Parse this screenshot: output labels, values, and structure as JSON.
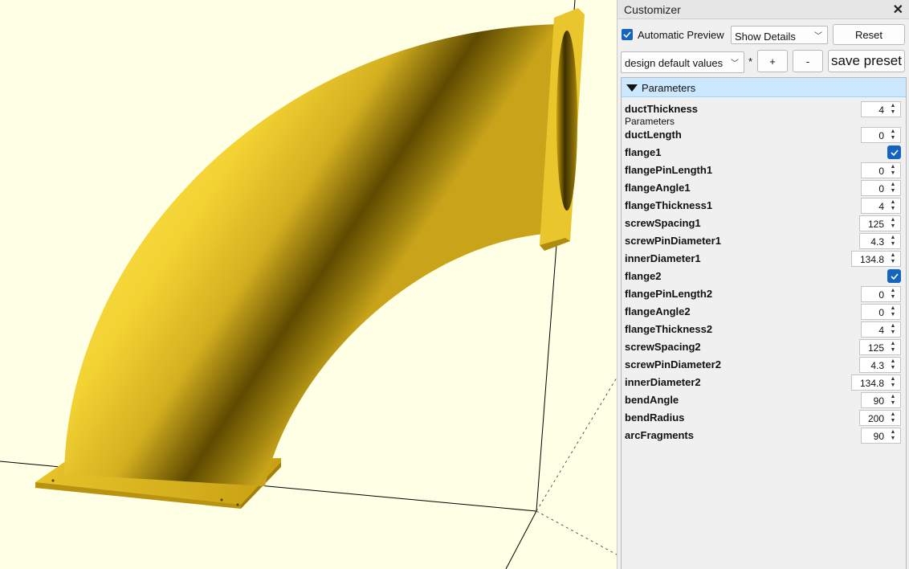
{
  "customizer": {
    "title": "Customizer",
    "close_symbol": "✕",
    "automatic_preview_label": "Automatic Preview",
    "automatic_preview_checked": true,
    "details_select": "Show Details",
    "reset_label": "Reset",
    "preset_select": "design default values",
    "modified_marker": "*",
    "add_label": "+",
    "remove_label": "-",
    "save_preset_label": "save preset",
    "group_title": "Parameters",
    "accent_color": "#1565c0",
    "header_color": "#cce8ff"
  },
  "viewport": {
    "model_color": "#f5d63a",
    "background_color": "#ffffe5"
  },
  "parameters": [
    {
      "name": "ductThickness",
      "value": "4",
      "description": "Parameters"
    },
    {
      "name": "ductLength",
      "value": "0"
    },
    {
      "name": "flange1",
      "checked": true
    },
    {
      "name": "flangePinLength1",
      "value": "0"
    },
    {
      "name": "flangeAngle1",
      "value": "0"
    },
    {
      "name": "flangeThickness1",
      "value": "4"
    },
    {
      "name": "screwSpacing1",
      "value": "125"
    },
    {
      "name": "screwPinDiameter1",
      "value": "4.3"
    },
    {
      "name": "innerDiameter1",
      "value": "134.8"
    },
    {
      "name": "flange2",
      "checked": true
    },
    {
      "name": "flangePinLength2",
      "value": "0"
    },
    {
      "name": "flangeAngle2",
      "value": "0"
    },
    {
      "name": "flangeThickness2",
      "value": "4"
    },
    {
      "name": "screwSpacing2",
      "value": "125"
    },
    {
      "name": "screwPinDiameter2",
      "value": "4.3"
    },
    {
      "name": "innerDiameter2",
      "value": "134.8"
    },
    {
      "name": "bendAngle",
      "value": "90"
    },
    {
      "name": "bendRadius",
      "value": "200"
    },
    {
      "name": "arcFragments",
      "value": "90"
    }
  ]
}
